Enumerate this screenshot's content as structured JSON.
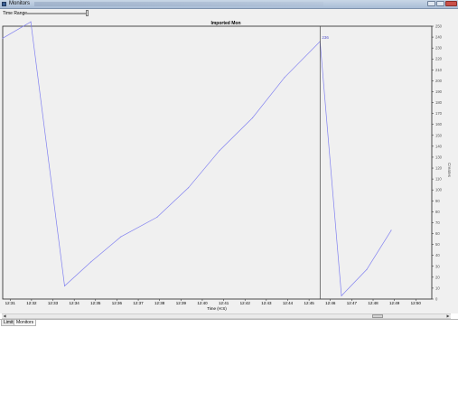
{
  "window": {
    "title": "Monitors"
  },
  "toolbar": {
    "time_range_label": "Time Range"
  },
  "tabs": [
    {
      "label": "Limits",
      "active": false
    },
    {
      "label": "Monitors",
      "active": true
    }
  ],
  "colors": {
    "series": "#8080f0",
    "plot_bg": "#f0f0f0",
    "cursor_line": "#444444",
    "tooltip_text": "#5555cc"
  },
  "chart_data": {
    "type": "line",
    "title": "Imported Mon",
    "xlabel": "Time (H:S)",
    "ylabel": "Creates",
    "x_ticks": [
      "12:31",
      "12:32",
      "12:33",
      "12:34",
      "12:35",
      "12:36",
      "12:37",
      "12:38",
      "12:39",
      "12:40",
      "12:41",
      "12:42",
      "12:43",
      "12:44",
      "12:45",
      "12:46",
      "12:47",
      "12:48",
      "12:49",
      "12:50"
    ],
    "y_ticks": [
      0,
      10,
      20,
      30,
      40,
      50,
      60,
      70,
      80,
      90,
      100,
      110,
      120,
      130,
      140,
      150,
      160,
      170,
      180,
      190,
      200,
      210,
      220,
      230,
      240,
      250
    ],
    "ylim": [
      0,
      250
    ],
    "xlim": [
      "12:30:39",
      "12:50:45"
    ],
    "grid": false,
    "series": [
      {
        "x": [
          "12:30:39",
          "12:31:58",
          "12:33:33",
          "12:34:47",
          "12:36:11",
          "12:37:53",
          "12:39:21",
          "12:40:48",
          "12:42:21",
          "12:43:51",
          "12:45:31",
          "12:46:31",
          "12:47:42",
          "12:48:51"
        ],
        "values": [
          239,
          254,
          12,
          34,
          57,
          75,
          102,
          136,
          166,
          203,
          236,
          3,
          27,
          63
        ]
      }
    ],
    "cursor": {
      "x": "12:45:31",
      "label": "236"
    }
  }
}
